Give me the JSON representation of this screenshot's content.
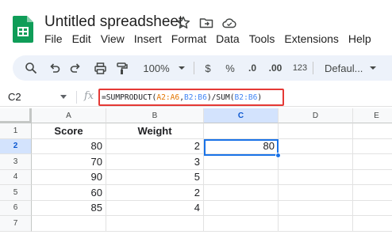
{
  "app": {
    "title": "Untitled spreadsheet",
    "menu": [
      "File",
      "Edit",
      "View",
      "Insert",
      "Format",
      "Data",
      "Tools",
      "Extensions",
      "Help"
    ]
  },
  "toolbar": {
    "zoom": "100%",
    "currency": "$",
    "percent": "%",
    "decrease_decimals": ".0",
    "increase_decimals": ".00",
    "number_format": "123",
    "font": "Defaul..."
  },
  "formula_bar": {
    "cell_ref": "C2",
    "fx": "fx",
    "formula_parts": [
      {
        "text": "=SUMPRODUCT(",
        "kind": "plain"
      },
      {
        "text": "A2:A6",
        "kind": "range1"
      },
      {
        "text": ",",
        "kind": "plain"
      },
      {
        "text": "B2:B6",
        "kind": "range2"
      },
      {
        "text": ")/SUM(",
        "kind": "plain"
      },
      {
        "text": "B2:B6",
        "kind": "range2"
      },
      {
        "text": ")",
        "kind": "plain"
      }
    ]
  },
  "grid": {
    "columns": [
      "A",
      "B",
      "C",
      "D",
      "E"
    ],
    "rows": [
      "1",
      "2",
      "3",
      "4",
      "5",
      "6",
      "7"
    ],
    "selected_column": "C",
    "selected_row": "2",
    "cells": [
      [
        "Score",
        "Weight",
        "",
        "",
        ""
      ],
      [
        "80",
        "2",
        "80",
        "",
        ""
      ],
      [
        "70",
        "3",
        "",
        "",
        ""
      ],
      [
        "90",
        "5",
        "",
        "",
        ""
      ],
      [
        "60",
        "2",
        "",
        "",
        ""
      ],
      [
        "85",
        "4",
        "",
        "",
        ""
      ],
      [
        "",
        "",
        "",
        "",
        ""
      ]
    ]
  },
  "colors": {
    "range1": "#e37400",
    "range2": "#4285f4",
    "selection": "#1a73e8",
    "highlight": "#e53935"
  }
}
